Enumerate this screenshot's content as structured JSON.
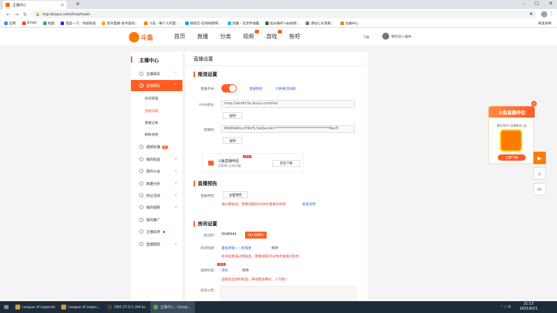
{
  "browser": {
    "tab_title": "主播中心",
    "tab_close": "×",
    "new_tab": "+",
    "window_controls": [
      "–",
      "☐",
      "✕"
    ],
    "url": "mp.douyu.com/live/main",
    "bookmarks": [
      "应用",
      "Gmail",
      "地图",
      "百度一下，你就知道",
      "虎牙直播-技术驱动...",
      "斗鱼 - 每个人的直...",
      "微软云-在线视频网...",
      "优酷 - 这世界很酷",
      "超长解析-vip视频...",
      "源站七天观看...",
      "主播中心"
    ],
    "other_bookmarks": "阅读清单"
  },
  "site": {
    "logo_text": "斗鱼",
    "nav": [
      "首页",
      "直播",
      "分类",
      "视频",
      "游戏",
      "鱼吧"
    ],
    "download": "下载",
    "username": "脚玩的小猫咪"
  },
  "sidebar": {
    "title": "主播中心",
    "items": [
      {
        "label": "主播相关",
        "arrow": "^"
      },
      {
        "label": "直播相关",
        "arrow": "^"
      },
      {
        "label": "视频轮播",
        "tag": "新"
      },
      {
        "label": "我的收益",
        "arrow": "v"
      },
      {
        "label": "我的公会",
        "arrow": "v"
      },
      {
        "label": "数据分析",
        "arrow": "v"
      },
      {
        "label": "商业活动",
        "arrow": "v"
      },
      {
        "label": "我的视频",
        "arrow": "v"
      },
      {
        "label": "我的推广"
      },
      {
        "label": "主播扶持"
      },
      {
        "label": "直播帮助",
        "arrow": "v"
      }
    ],
    "subitems": [
      "房间管理",
      "直播设置",
      "直播记录",
      "刷粉视频"
    ]
  },
  "main": {
    "title": "直播设置",
    "stream": {
      "header": "推流设置",
      "switch_label": "直播开关：",
      "link_tutorial": "直播教程",
      "link_line": "切换推流线路",
      "rtmp_label": "rtmp地址：",
      "rtmp_value": "rtmp://sendtc3a.douyu.com/live",
      "copy": "复制",
      "code_label": "直播码：",
      "code_value": "9948944rsuTI9lcFL?wsSecret=********************************8wsTi",
      "copy2": "复制"
    },
    "promo": {
      "title": "斗鱼直播伴侣",
      "subtitle": "仅需要1分钟开播",
      "new": "NEW",
      "button": "前往下载"
    },
    "preview": {
      "header": "直播预告",
      "label": "直播预告：",
      "button": "设置预告",
      "warn": "通过审核后，需要间隔10分钟才能再次修改",
      "link": "查看说明"
    },
    "room": {
      "header": "房间设置",
      "id_label": "房间ID：",
      "id_value": "9948944",
      "enter_button": "进入直播间",
      "title_label": "房间标题：",
      "title_value": "最强英雄——卧榻者",
      "edit": "修改",
      "title_warn": "房间标题通过审核后，需要间隔10分钟才能再次修改",
      "tag_label": "选择标签：",
      "tag_new": "NEW",
      "tag_link": "添加",
      "tag_edit": "修改",
      "tag_warn": "选择适合你的标签，获得更多曝光、人气哦~",
      "notice_label": "房间公告："
    }
  },
  "float": {
    "title": "斗鱼直播伴侣",
    "subtitle": "最好用的PC直播推流工具",
    "button": "立即下载",
    "close": "×"
  },
  "taskbar": {
    "tasks": [
      {
        "label": "League of Legends",
        "color": "#c8a040"
      },
      {
        "label": "League of Legen...",
        "color": "#c8a040"
      },
      {
        "label": "OBS 27.0.1 (64-bi...",
        "color": "#333"
      },
      {
        "label": "主播中心 - Googl...",
        "color": "#4caf50"
      }
    ],
    "time": "21:13",
    "date": "2021/8/21"
  }
}
